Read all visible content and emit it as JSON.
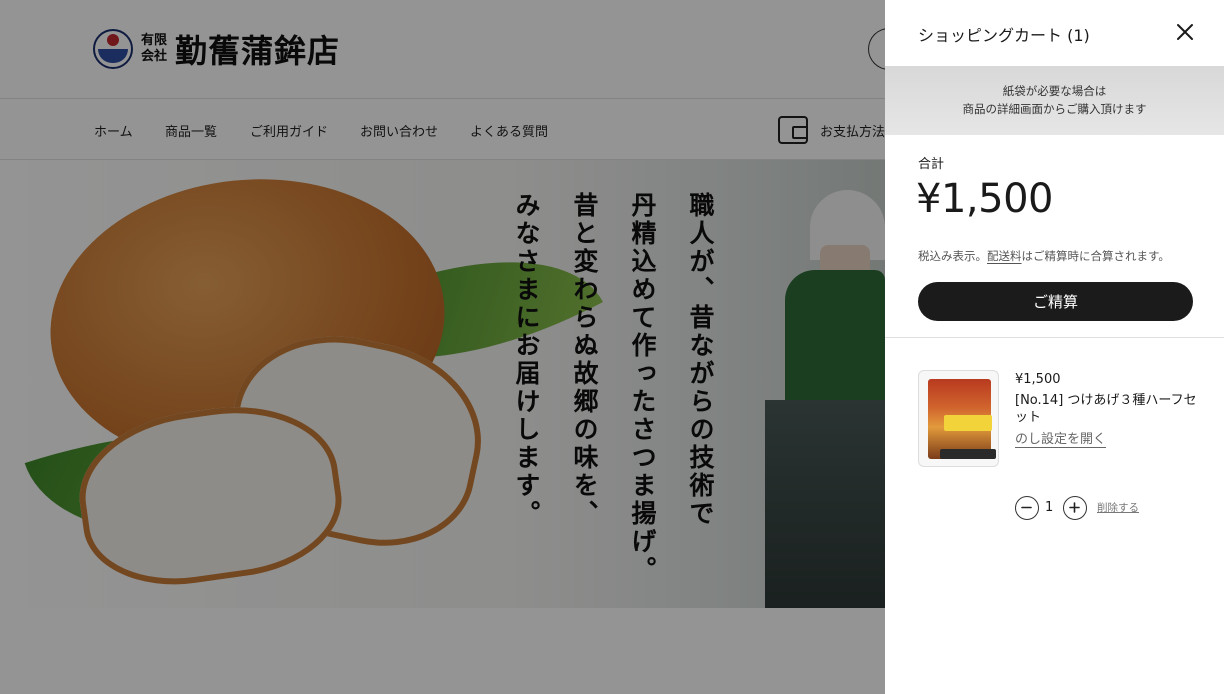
{
  "site": {
    "logo_small_line1": "有限",
    "logo_small_line2": "会社",
    "logo_text": "勤𦾔蒲鉾店",
    "nav": [
      "ホーム",
      "商品一覧",
      "ご利用ガイド",
      "お問い合わせ",
      "よくある質問"
    ],
    "payment_label": "お支払方法"
  },
  "hero": {
    "copy_lines": [
      "職人が、昔ながらの技術で",
      "丹精込めて作ったさつま揚げ。",
      "昔と変わらぬ故郷の味を、",
      "みなさまにお届けします。"
    ]
  },
  "cart": {
    "title": "ショッピングカート (1)",
    "notice_line1": "紙袋が必要な場合は",
    "notice_line2": "商品の詳細画面からご購入頂けます",
    "total_label": "合計",
    "total_value": "¥1,500",
    "tax_prefix": "税込み表示。",
    "shipping_link": "配送料",
    "tax_suffix": "はご精算時に合算されます。",
    "checkout_label": "ご精算",
    "item": {
      "price": "¥1,500",
      "name": "[No.14] つけあげ３種ハーフセット",
      "noshi_link": "のし設定を開く",
      "quantity": "1",
      "remove_label": "削除する"
    }
  },
  "colors": {
    "checkout_button": "#1b1b1b",
    "overlay": "rgba(0,0,0,0.42)",
    "notice_bg": "#dcdcdc"
  },
  "icons": [
    "close-icon",
    "wallet-icon",
    "minus-icon",
    "plus-icon"
  ]
}
